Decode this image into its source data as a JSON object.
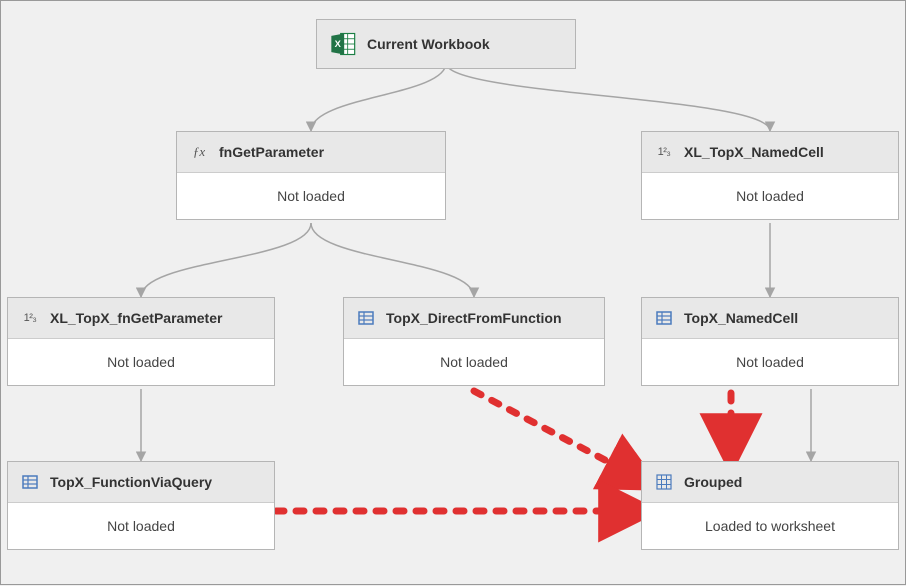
{
  "diagram": {
    "root": {
      "label": "Current Workbook",
      "iconName": "excel-icon"
    },
    "nodes": {
      "fnGetParameter": {
        "title": "fnGetParameter",
        "status": "Not loaded",
        "iconName": "fx-icon"
      },
      "xlTopxNamedCell": {
        "title": "XL_TopX_NamedCell",
        "status": "Not loaded",
        "iconName": "number-icon"
      },
      "xlTopxFnGetParameter": {
        "title": "XL_TopX_fnGetParameter",
        "status": "Not loaded",
        "iconName": "number-icon"
      },
      "topxDirectFromFunction": {
        "title": "TopX_DirectFromFunction",
        "status": "Not loaded",
        "iconName": "table-icon"
      },
      "topxNamedCell": {
        "title": "TopX_NamedCell",
        "status": "Not loaded",
        "iconName": "table-icon"
      },
      "topxFunctionViaQuery": {
        "title": "TopX_FunctionViaQuery",
        "status": "Not loaded",
        "iconName": "table-icon"
      },
      "grouped": {
        "title": "Grouped",
        "status": "Loaded to worksheet",
        "iconName": "grid-icon"
      }
    },
    "edges_solid": [
      {
        "from": "root",
        "to": "fnGetParameter"
      },
      {
        "from": "root",
        "to": "xlTopxNamedCell"
      },
      {
        "from": "fnGetParameter",
        "to": "xlTopxFnGetParameter"
      },
      {
        "from": "fnGetParameter",
        "to": "topxDirectFromFunction"
      },
      {
        "from": "xlTopxNamedCell",
        "to": "topxNamedCell"
      },
      {
        "from": "xlTopxFnGetParameter",
        "to": "topxFunctionViaQuery"
      },
      {
        "from": "topxNamedCell",
        "to": "grouped"
      }
    ],
    "edges_dashed_red": [
      {
        "from": "topxDirectFromFunction",
        "to": "grouped"
      },
      {
        "from": "topxNamedCell",
        "to": "grouped"
      },
      {
        "from": "topxFunctionViaQuery",
        "to": "grouped"
      }
    ]
  }
}
